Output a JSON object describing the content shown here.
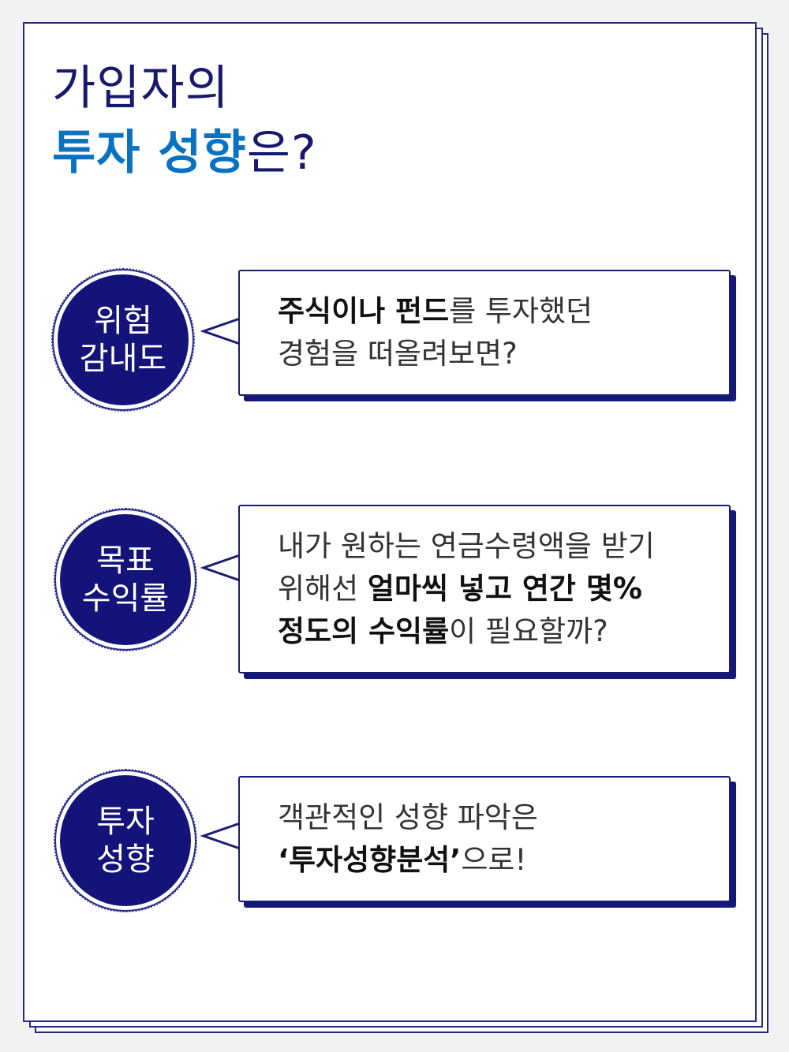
{
  "heading": {
    "line1": "가입자의",
    "line2_highlight": "투자 성향",
    "line2_rest": "은?"
  },
  "colors": {
    "navy": "#14137a",
    "blue": "#0a73c1",
    "border": "#242b87"
  },
  "items": [
    {
      "circle": [
        "위험",
        "감내도"
      ],
      "lines": [
        [
          {
            "t": "주식이나 펀드",
            "b": true
          },
          {
            "t": "를 투자했던",
            "b": false
          }
        ],
        [
          {
            "t": "경험을 떠올려보면?",
            "b": false
          }
        ]
      ]
    },
    {
      "circle": [
        "목표",
        "수익률"
      ],
      "lines": [
        [
          {
            "t": "내가 원하는 연금수령액을 받기",
            "b": false
          }
        ],
        [
          {
            "t": "위해선 ",
            "b": false
          },
          {
            "t": "얼마씩 넣고 연간 몇%",
            "b": true
          }
        ],
        [
          {
            "t": "정도의 수익률",
            "b": true
          },
          {
            "t": "이 필요할까?",
            "b": false
          }
        ]
      ]
    },
    {
      "circle": [
        "투자",
        "성향"
      ],
      "lines": [
        [
          {
            "t": "객관적인 성향 파악은",
            "b": false
          }
        ],
        [
          {
            "t": "‘투자성향분석’",
            "b": true
          },
          {
            "t": "으로!",
            "b": false
          }
        ]
      ]
    }
  ]
}
